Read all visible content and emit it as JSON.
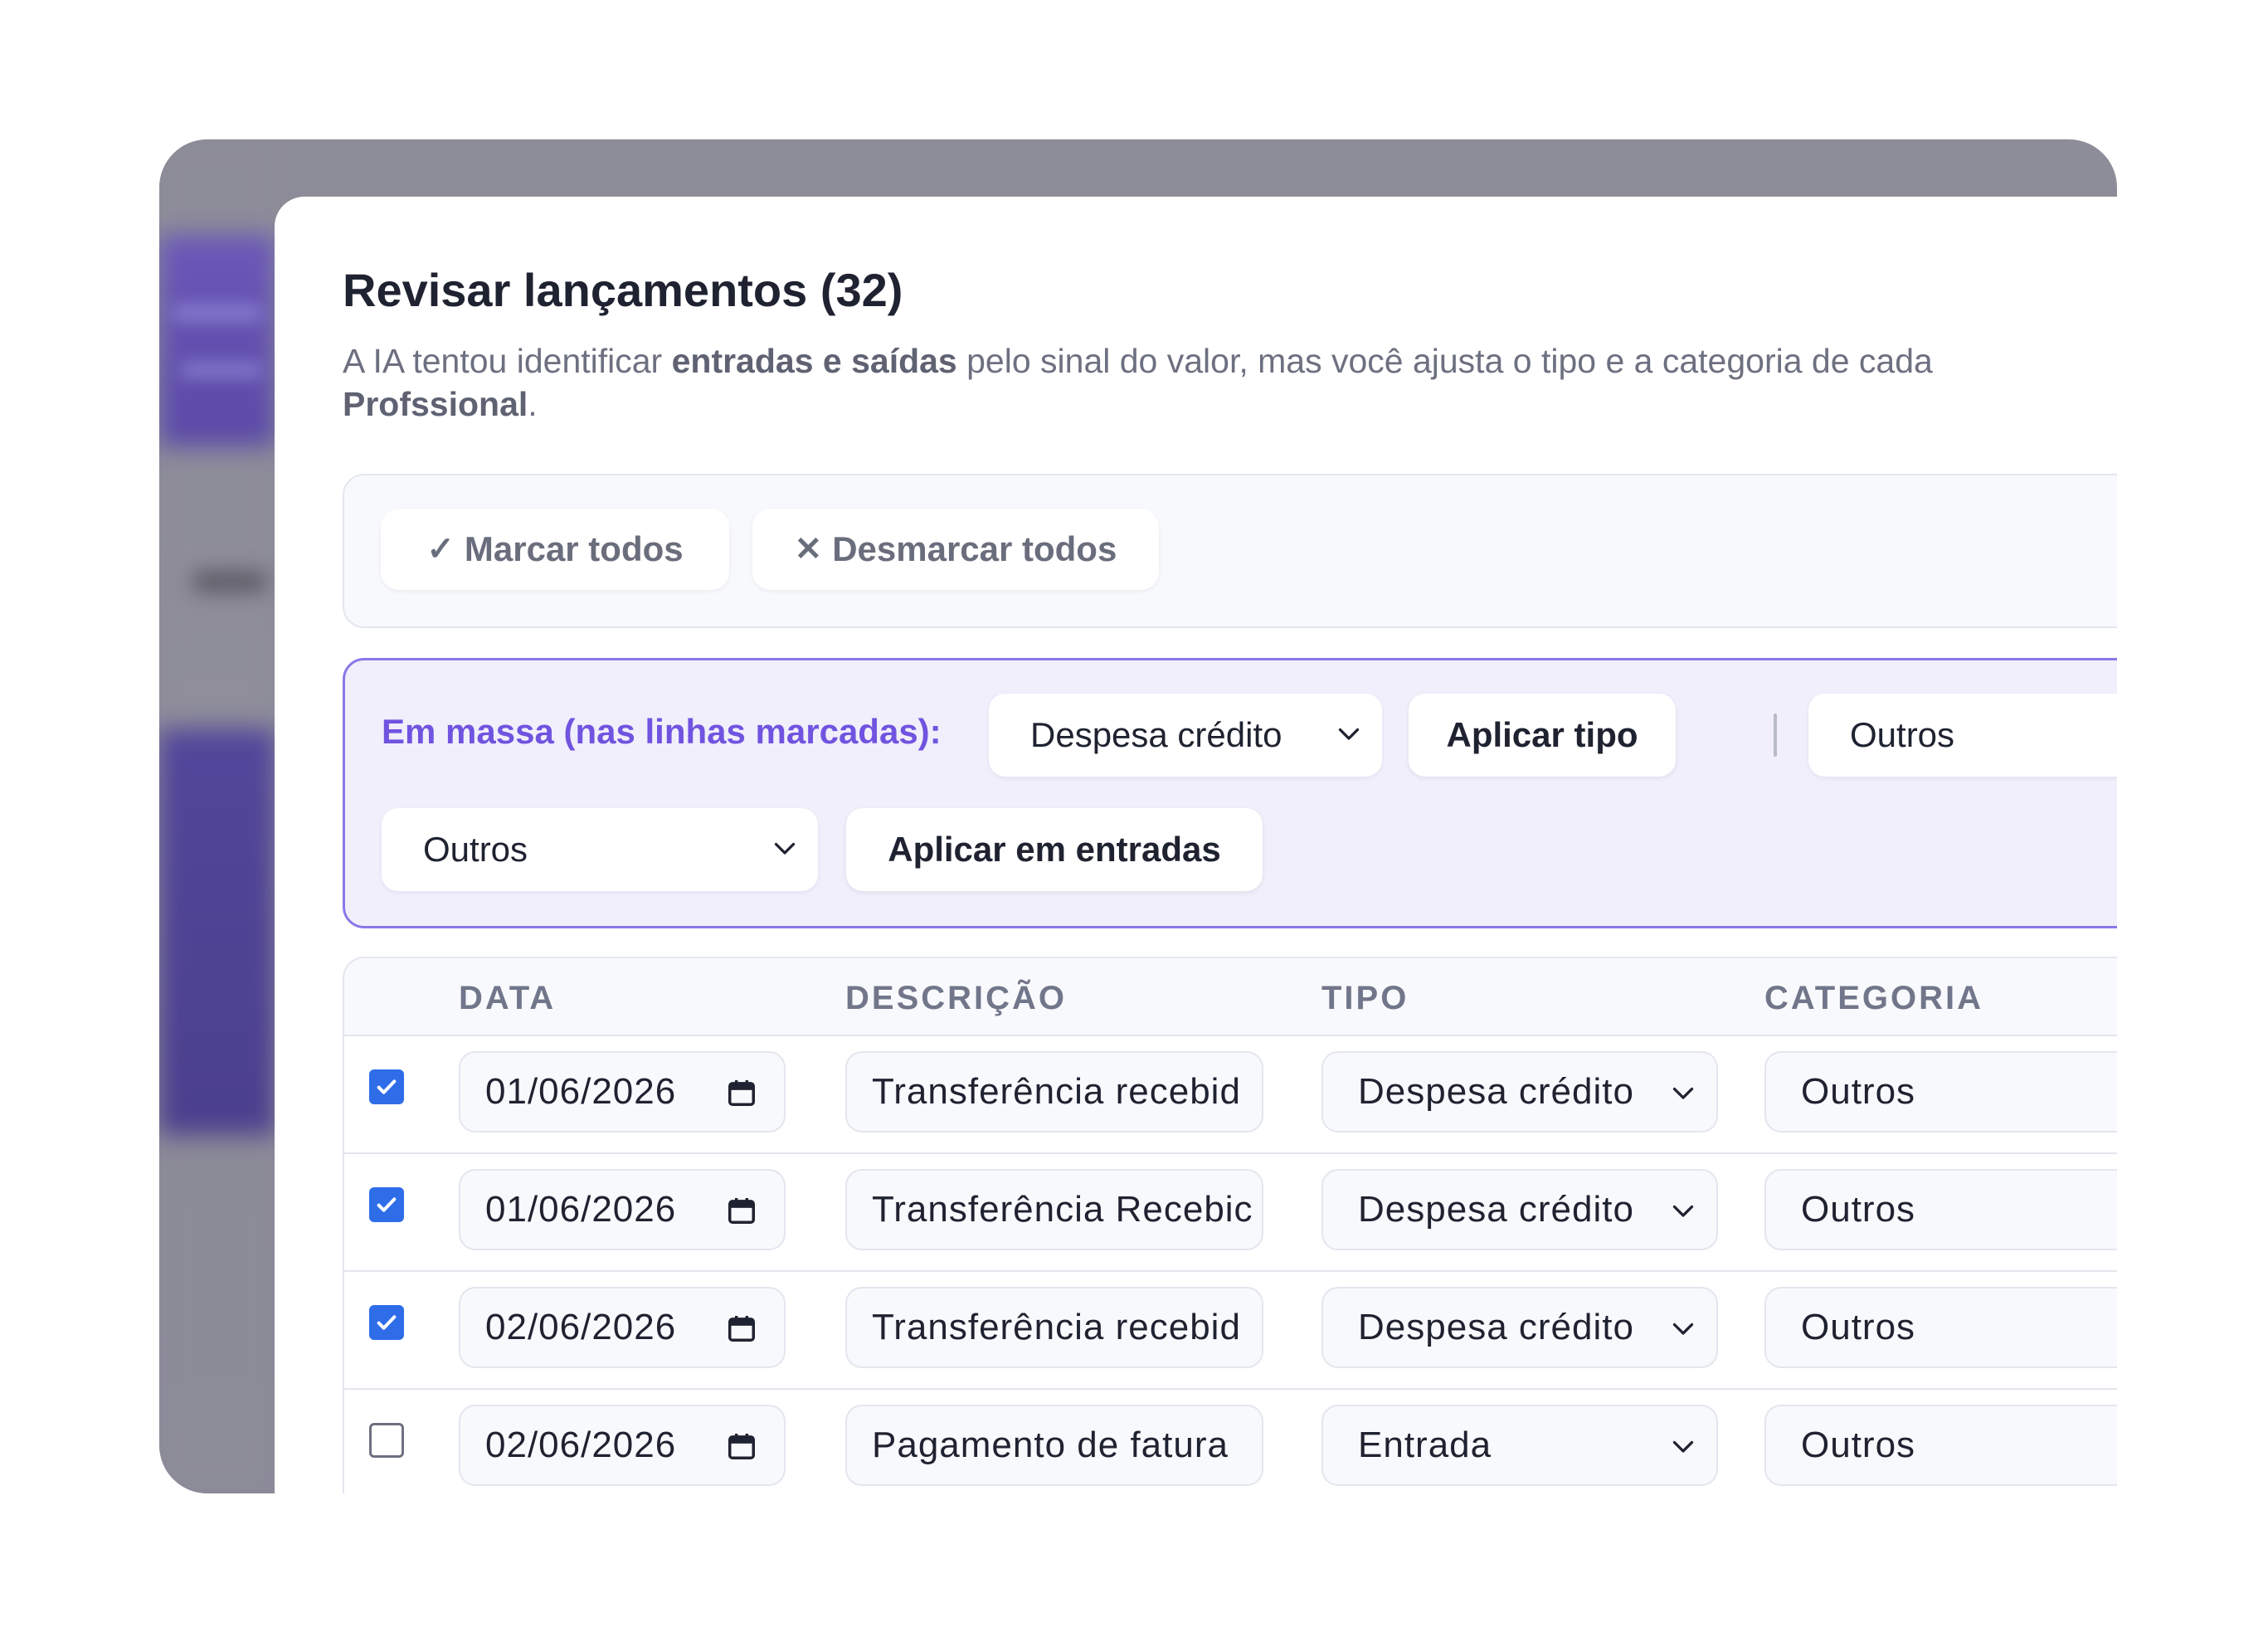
{
  "modal": {
    "title": "Revisar lançamentos (32)",
    "description": {
      "part1": "A IA tentou identificar ",
      "bold1": "entradas e saídas",
      "part2": " pelo sinal do valor, mas você ajusta o tipo e a categoria de cada",
      "bold2": "Profssional",
      "part3": "."
    }
  },
  "toolbar": {
    "select_all": {
      "icon": "✓",
      "label": "Marcar todos"
    },
    "deselect_all": {
      "icon": "✕",
      "label": "Desmarcar todos"
    }
  },
  "bulk": {
    "label": "Em massa (nas linhas marcadas):",
    "type_select": "Despesa crédito",
    "apply_type": "Aplicar tipo",
    "category_select_1": "Outros",
    "category_select_2": "Outros",
    "apply_entries": "Aplicar em entradas"
  },
  "table": {
    "headers": {
      "date": "DATA",
      "description": "DESCRIÇÃO",
      "type": "TIPO",
      "category": "CATEGORIA"
    },
    "rows": [
      {
        "checked": true,
        "date": "01/06/2026",
        "description": "Transferência recebid",
        "type": "Despesa crédito",
        "category": "Outros"
      },
      {
        "checked": true,
        "date": "01/06/2026",
        "description": "Transferência Recebic",
        "type": "Despesa crédito",
        "category": "Outros"
      },
      {
        "checked": true,
        "date": "02/06/2026",
        "description": "Transferência recebid",
        "type": "Despesa crédito",
        "category": "Outros"
      },
      {
        "checked": false,
        "date": "02/06/2026",
        "description": "Pagamento de fatura",
        "type": "Entrada",
        "category": "Outros"
      }
    ]
  },
  "colors": {
    "accent": "#7054e0",
    "checkbox": "#2f6de8",
    "text": "#1f2230",
    "muted": "#6d7080"
  }
}
